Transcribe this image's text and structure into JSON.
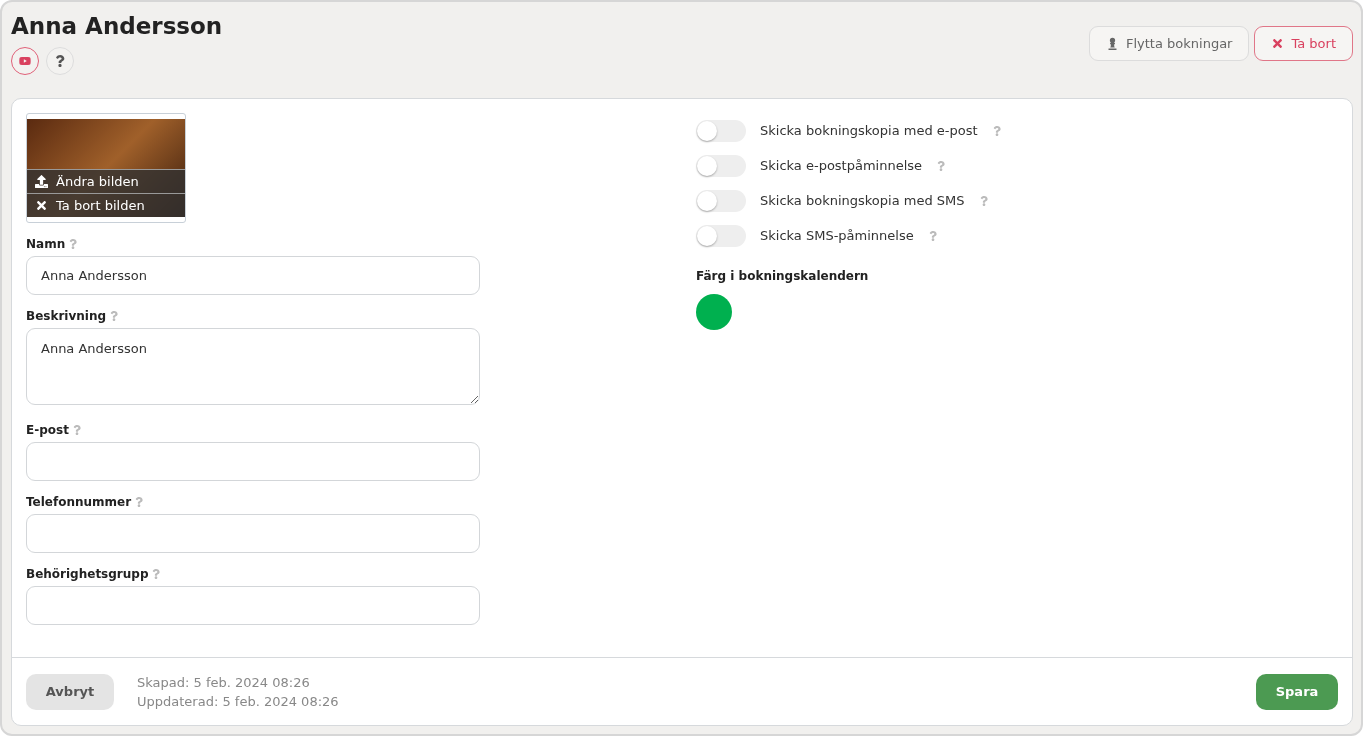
{
  "title": "Anna Andersson",
  "header_buttons": [
    {
      "kind": "move",
      "label": "Flytta bokningar"
    },
    {
      "kind": "delete",
      "label": "Ta bort"
    }
  ],
  "image": {
    "actions": [
      {
        "kind": "upload",
        "label": "Ändra bilden"
      },
      {
        "kind": "remove",
        "label": "Ta bort bilden"
      }
    ]
  },
  "fields": [
    {
      "kind": "input",
      "label": "Namn",
      "value": "Anna Andersson"
    },
    {
      "kind": "textarea",
      "label": "Beskrivning",
      "value": "Anna Andersson"
    },
    {
      "kind": "input",
      "label": "E-post"
    },
    {
      "kind": "input",
      "label": "Telefonnummer"
    },
    {
      "kind": "input",
      "label": "Behörighetsgrupp"
    }
  ],
  "toggles": [
    {
      "label": "Skicka bokningskopia med e-post",
      "on": false
    },
    {
      "label": "Skicka e-postpåminnelse",
      "on": false
    },
    {
      "label": "Skicka bokningskopia med SMS",
      "on": false
    },
    {
      "label": "Skicka SMS-påminnelse",
      "on": false
    }
  ],
  "calendar_color": {
    "label": "Färg i bokningskalendern",
    "color": "#00b04f"
  },
  "footer": {
    "cancel": "Avbryt",
    "created": "Skapad: 5 feb. 2024 08:26",
    "updated": "Uppdaterad: 5 feb. 2024 08:26",
    "save": "Spara"
  }
}
